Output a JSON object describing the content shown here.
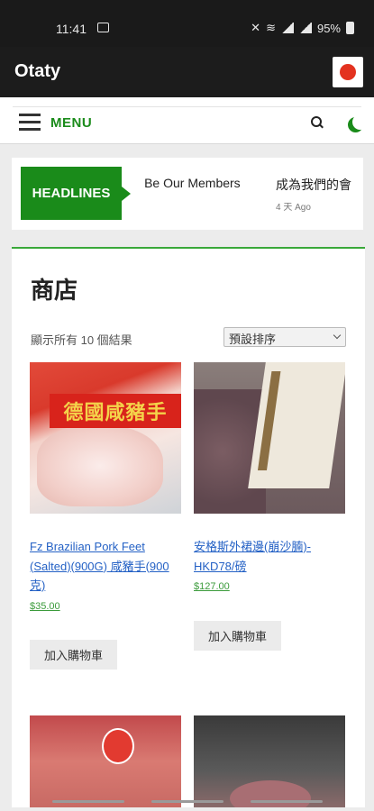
{
  "status_bar": {
    "time": "11:41",
    "battery": "95%"
  },
  "app_bar": {
    "title": "Otaty"
  },
  "nav": {
    "menu_label": "MENU"
  },
  "headlines": {
    "badge": "HEADLINES",
    "items": [
      {
        "title": " Be Our Members"
      },
      {
        "title": "成為我們的會",
        "time": "4 天 Ago"
      }
    ]
  },
  "shop": {
    "title": "商店",
    "result_count": "顯示所有 10 個結果",
    "sort": {
      "selected": "預設排序"
    },
    "products": [
      {
        "name": "Fz Brazilian Pork Feet (Salted)(900G) 咸豬手(900克)",
        "price": "$35.00",
        "image_label": "德國咸豬手",
        "button": "加入購物車"
      },
      {
        "name": "安格斯外裙邊(崩沙腩)-HKD78/磅",
        "price": "$127.00",
        "button": "加入購物車"
      }
    ]
  }
}
